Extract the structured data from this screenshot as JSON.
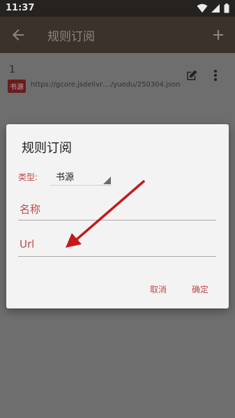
{
  "status_bar": {
    "time": "11:37"
  },
  "app_bar": {
    "title": "规则订阅"
  },
  "list": {
    "items": [
      {
        "index": "1",
        "tag": "书源",
        "url": "https://gcore.jsdelivr..../yuedu/250304.json"
      }
    ]
  },
  "dialog": {
    "title": "规则订阅",
    "type_label": "类型:",
    "type_value": "书源",
    "name_placeholder": "名称",
    "url_placeholder": "Url",
    "cancel_label": "取消",
    "ok_label": "确定"
  },
  "colors": {
    "accent": "#c24a4a",
    "app_bar": "#3b322b",
    "annotation_arrow": "#c41a1a"
  },
  "icons": [
    "wifi-icon",
    "signal-icon",
    "battery-icon",
    "back-arrow-icon",
    "add-icon",
    "edit-icon",
    "more-vert-icon",
    "dropdown-triangle-icon",
    "annotation-arrow"
  ]
}
